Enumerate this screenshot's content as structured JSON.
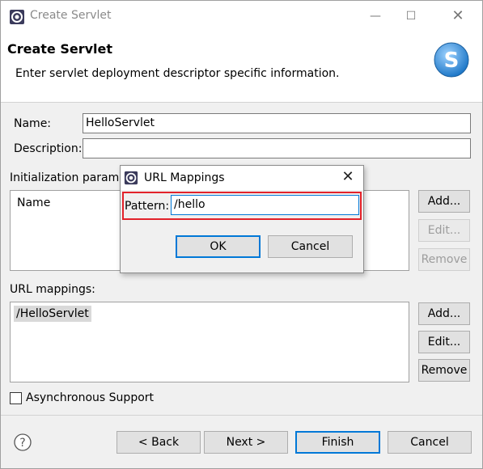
{
  "window": {
    "title": "Create Servlet",
    "minimize_glyph": "—",
    "maximize_glyph": "☐",
    "close_glyph": "✕"
  },
  "banner": {
    "title": "Create Servlet",
    "description": "Enter servlet deployment descriptor specific information.",
    "logo_letter": "S"
  },
  "form": {
    "name_label": "Name:",
    "name_value": "HelloServlet",
    "description_label": "Description:",
    "description_value": "",
    "init_params_label": "Initialization parame",
    "init_params_column": "Name",
    "init_buttons": {
      "add": "Add...",
      "edit": "Edit...",
      "remove": "Remove"
    },
    "url_mappings_label": "URL mappings:",
    "url_mappings": [
      "/HelloServlet"
    ],
    "url_buttons": {
      "add": "Add...",
      "edit": "Edit...",
      "remove": "Remove"
    },
    "async_label": "Asynchronous Support",
    "async_checked": false
  },
  "footer": {
    "help_glyph": "?",
    "back": "< Back",
    "next": "Next >",
    "finish": "Finish",
    "cancel": "Cancel"
  },
  "dialog": {
    "title": "URL Mappings",
    "close_glyph": "✕",
    "pattern_label": "Pattern:",
    "pattern_value": "/hello",
    "ok": "OK",
    "cancel": "Cancel"
  },
  "colors": {
    "accent": "#0078d7",
    "highlight": "#e2222a",
    "logo_blue": "#2f8fd8"
  },
  "icons": {
    "app": "eclipse-gear-icon",
    "banner_logo": "servlet-s-logo-icon",
    "help": "help-icon"
  }
}
